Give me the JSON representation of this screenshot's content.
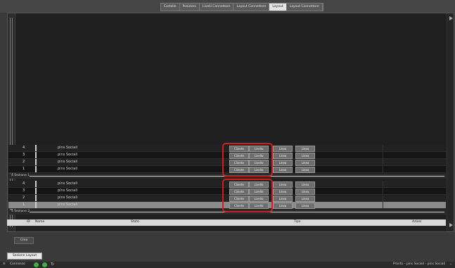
{
  "tabs": [
    "Cartelle",
    "Posizioni",
    "Livelli Connettore",
    "Layout Connettore",
    "Layout",
    "Layout Connettore"
  ],
  "active_tab_index": 4,
  "groups": [
    {
      "label": "4 Sezione 1",
      "rows": [
        {
          "num": "4",
          "name": "pins Sociali",
          "b1": "Cliente",
          "b2": "Livello",
          "b3": "Linea",
          "b4": "Linea",
          "style": "alt"
        },
        {
          "num": "3",
          "name": "pins Sociali",
          "b1": "Cliente",
          "b2": "Livello",
          "b3": "Linea",
          "b4": "Linea",
          "style": ""
        },
        {
          "num": "2",
          "name": "pins Sociali",
          "b1": "Cliente",
          "b2": "Livello",
          "b3": "Linea",
          "b4": "Linea",
          "style": "alt"
        },
        {
          "num": "1",
          "name": "pins Sociali",
          "b1": "Cliente",
          "b2": "Livello",
          "b3": "Linea",
          "b4": "Linea",
          "style": ""
        }
      ]
    },
    {
      "label": "4 Sezione 2",
      "rows": [
        {
          "num": "4",
          "name": "pins Sociali",
          "b1": "Cliente",
          "b2": "Livello",
          "b3": "Linea",
          "b4": "Linea",
          "style": "alt"
        },
        {
          "num": "3",
          "name": "pins Sociali",
          "b1": "Cliente",
          "b2": "Livello",
          "b3": "Linea",
          "b4": "Linea",
          "style": ""
        },
        {
          "num": "2",
          "name": "pins Sociali",
          "b1": "Cliente",
          "b2": "Livello",
          "b3": "Linea",
          "b4": "Linea",
          "style": "alt"
        },
        {
          "num": "1",
          "name": "pins Sociali",
          "b1": "Cliente",
          "b2": "Livello",
          "b3": "Linea",
          "b4": "Linea",
          "style": "sel"
        }
      ]
    }
  ],
  "header": {
    "col_id": "ID",
    "col_nome": "Nome",
    "col_stato": "Stato",
    "col_tipo": "Tipo",
    "col_azioni": "Azioni"
  },
  "action_button": "Crea",
  "bottom_tab": "Sezione Layout",
  "status": {
    "left_text": "Connesso",
    "right_text": "Pronto - pins Sociali - pins Sociali"
  },
  "colors": {
    "highlight": "#cc1f1f",
    "status_green": "#3cb043"
  }
}
